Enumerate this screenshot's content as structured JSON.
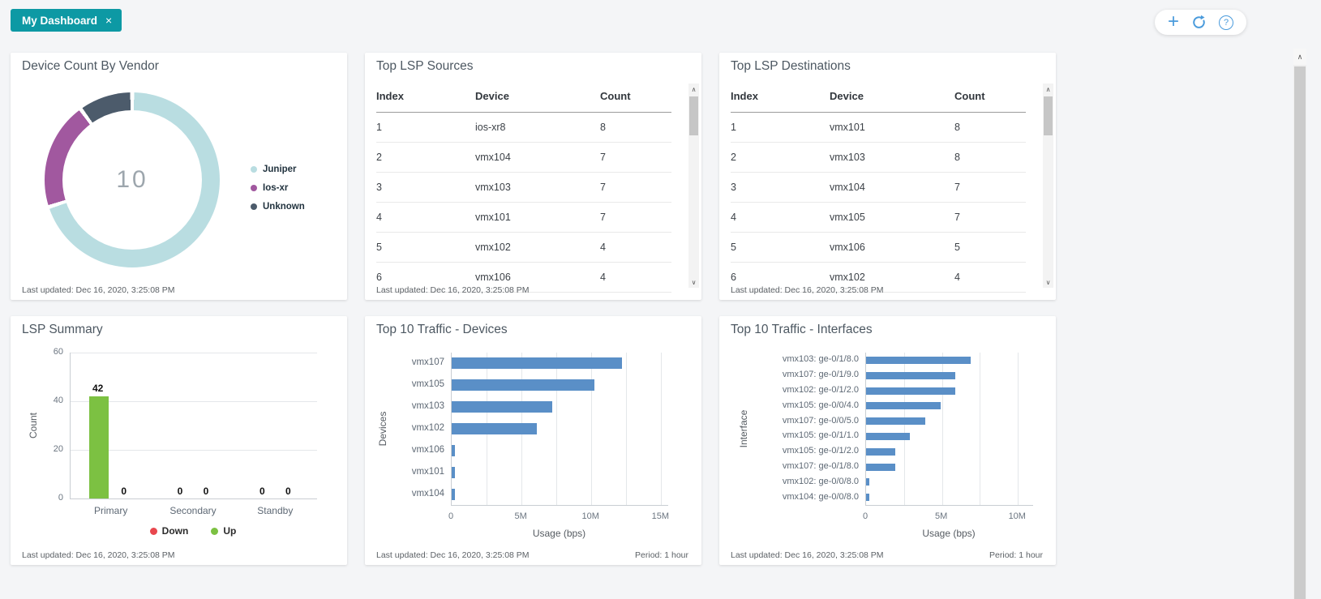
{
  "tab": {
    "label": "My Dashboard",
    "close_icon": "×"
  },
  "toolbar": {
    "add_icon": "+",
    "help_icon": "?"
  },
  "scrollbar": {
    "up_icon": "∧",
    "down_icon": "∨"
  },
  "panels": {
    "vendor": {
      "title": "Device Count By Vendor",
      "last_updated": "Last updated: Dec 16, 2020, 3:25:08 PM",
      "chart_data": {
        "type": "pie",
        "title": "Device Count By Vendor",
        "center_label": "10",
        "legend_position": "right",
        "slices": [
          {
            "label": "Juniper",
            "value": 7,
            "color": "#b9dde1"
          },
          {
            "label": "Ios-xr",
            "value": 2,
            "color": "#a1589f"
          },
          {
            "label": "Unknown",
            "value": 1,
            "color": "#4c5b6b"
          }
        ]
      }
    },
    "sources": {
      "title": "Top LSP Sources",
      "columns": [
        "Index",
        "Device",
        "Count"
      ],
      "rows": [
        [
          "1",
          "ios-xr8",
          "8"
        ],
        [
          "2",
          "vmx104",
          "7"
        ],
        [
          "3",
          "vmx103",
          "7"
        ],
        [
          "4",
          "vmx101",
          "7"
        ],
        [
          "5",
          "vmx102",
          "4"
        ],
        [
          "6",
          "vmx106",
          "4"
        ]
      ],
      "last_updated": "Last updated: Dec 16, 2020, 3:25:08 PM"
    },
    "destinations": {
      "title": "Top LSP Destinations",
      "columns": [
        "Index",
        "Device",
        "Count"
      ],
      "rows": [
        [
          "1",
          "vmx101",
          "8"
        ],
        [
          "2",
          "vmx103",
          "8"
        ],
        [
          "3",
          "vmx104",
          "7"
        ],
        [
          "4",
          "vmx105",
          "7"
        ],
        [
          "5",
          "vmx106",
          "5"
        ],
        [
          "6",
          "vmx102",
          "4"
        ]
      ],
      "last_updated": "Last updated: Dec 16, 2020, 3:25:08 PM"
    },
    "summary": {
      "title": "LSP Summary",
      "last_updated": "Last updated: Dec 16, 2020, 3:25:08 PM",
      "chart_data": {
        "type": "bar",
        "ylabel": "Count",
        "ylim": [
          0,
          60
        ],
        "yticks": [
          0,
          20,
          40,
          60
        ],
        "grid": true,
        "categories": [
          "Primary",
          "Secondary",
          "Standby"
        ],
        "series": [
          {
            "name": "Up",
            "color": "#7cc142",
            "values": [
              42,
              0,
              0
            ]
          },
          {
            "name": "Down",
            "color": "#e8474e",
            "values": [
              0,
              0,
              0
            ]
          }
        ],
        "legend": [
          {
            "label": "Down",
            "color": "#e8474e"
          },
          {
            "label": "Up",
            "color": "#7cc142"
          }
        ],
        "legend_position": "bottom"
      }
    },
    "traffic_devices": {
      "title": "Top 10 Traffic - Devices",
      "last_updated": "Last updated: Dec 16, 2020, 3:25:08 PM",
      "period": "Period: 1 hour",
      "chart_data": {
        "type": "bar",
        "orientation": "horizontal",
        "xlabel": "Usage (bps)",
        "ylabel": "Devices",
        "xlim": [
          0,
          15500000
        ],
        "gridline_step": 2500000,
        "bar_color": "#5a8fc7",
        "xticks": [
          {
            "label": "0",
            "value": 0
          },
          {
            "label": "5M",
            "value": 5000000
          },
          {
            "label": "10M",
            "value": 10000000
          },
          {
            "label": "15M",
            "value": 15000000
          }
        ],
        "categories": [
          "vmx107",
          "vmx105",
          "vmx103",
          "vmx102",
          "vmx106",
          "vmx101",
          "vmx104"
        ],
        "values": [
          12200000,
          10200000,
          7200000,
          6100000,
          250000,
          250000,
          250000
        ]
      }
    },
    "traffic_interfaces": {
      "title": "Top 10 Traffic - Interfaces",
      "last_updated": "Last updated: Dec 16, 2020, 3:25:08 PM",
      "period": "Period: 1 hour",
      "chart_data": {
        "type": "bar",
        "orientation": "horizontal",
        "xlabel": "Usage (bps)",
        "ylabel": "Interface",
        "xlim": [
          0,
          11000000
        ],
        "gridline_step": 2500000,
        "bar_color": "#5a8fc7",
        "xticks": [
          {
            "label": "0",
            "value": 0
          },
          {
            "label": "5M",
            "value": 5000000
          },
          {
            "label": "10M",
            "value": 10000000
          }
        ],
        "categories": [
          "vmx103: ge-0/1/8.0",
          "vmx107: ge-0/1/9.0",
          "vmx102: ge-0/1/2.0",
          "vmx105: ge-0/0/4.0",
          "vmx107: ge-0/0/5.0",
          "vmx105: ge-0/1/1.0",
          "vmx105: ge-0/1/2.0",
          "vmx107: ge-0/1/8.0",
          "vmx102: ge-0/0/8.0",
          "vmx104: ge-0/0/8.0"
        ],
        "values": [
          6900000,
          5900000,
          5900000,
          4900000,
          3900000,
          2900000,
          1900000,
          1900000,
          200000,
          200000
        ]
      }
    }
  }
}
